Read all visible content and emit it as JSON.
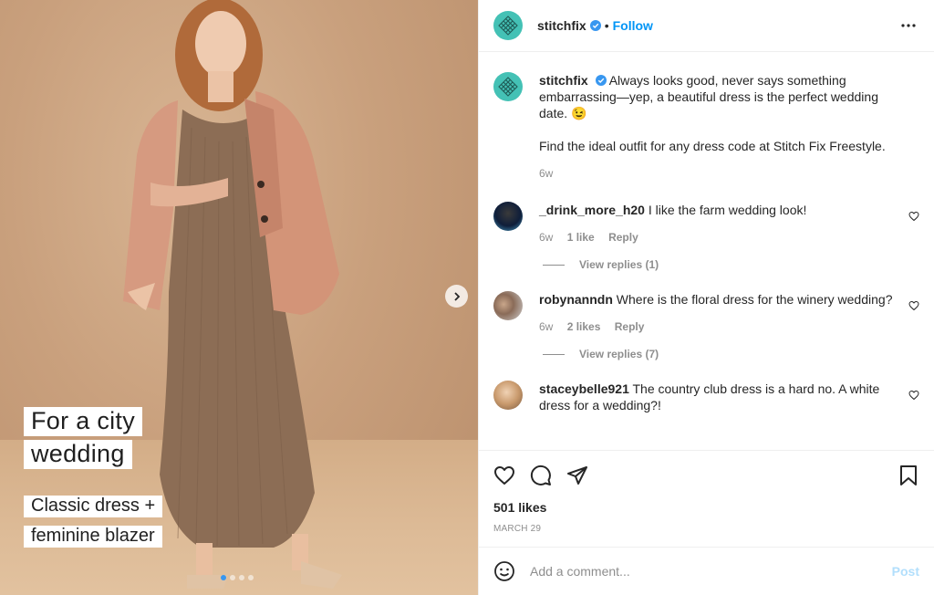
{
  "media": {
    "caption_title_1": "For a city",
    "caption_title_2": "wedding",
    "caption_sub_1": "Classic dress +",
    "caption_sub_2": "feminine blazer",
    "slides": 4,
    "active_slide": 1
  },
  "header": {
    "username": "stitchfix",
    "separator": "•",
    "follow_label": "Follow"
  },
  "caption": {
    "username": "stitchfix",
    "text": "Always looks good, never says something embarrassing—yep, a beautiful dress is the perfect wedding date. 😉",
    "text2": "Find the ideal outfit for any dress code at Stitch Fix Freestyle.",
    "age": "6w"
  },
  "comments": [
    {
      "username": "_drink_more_h20",
      "text": "I like the farm wedding look!",
      "age": "6w",
      "likes": "1 like",
      "reply": "Reply",
      "view_replies": "View replies (1)"
    },
    {
      "username": "robynanndn",
      "text": "Where is the floral dress for the winery wedding?",
      "age": "6w",
      "likes": "2 likes",
      "reply": "Reply",
      "view_replies": "View replies (7)"
    },
    {
      "username": "staceybelle921",
      "text": "The country club dress is a hard no. A white dress for a wedding?!"
    }
  ],
  "actions": {
    "likes": "501 likes",
    "date": "MARCH 29"
  },
  "add_comment": {
    "placeholder": "Add a comment...",
    "post_label": "Post"
  },
  "colors": {
    "brand": "#44c1b5",
    "link": "#0095f6",
    "muted": "#8e8e8e",
    "post_disabled": "#b2dffc"
  }
}
